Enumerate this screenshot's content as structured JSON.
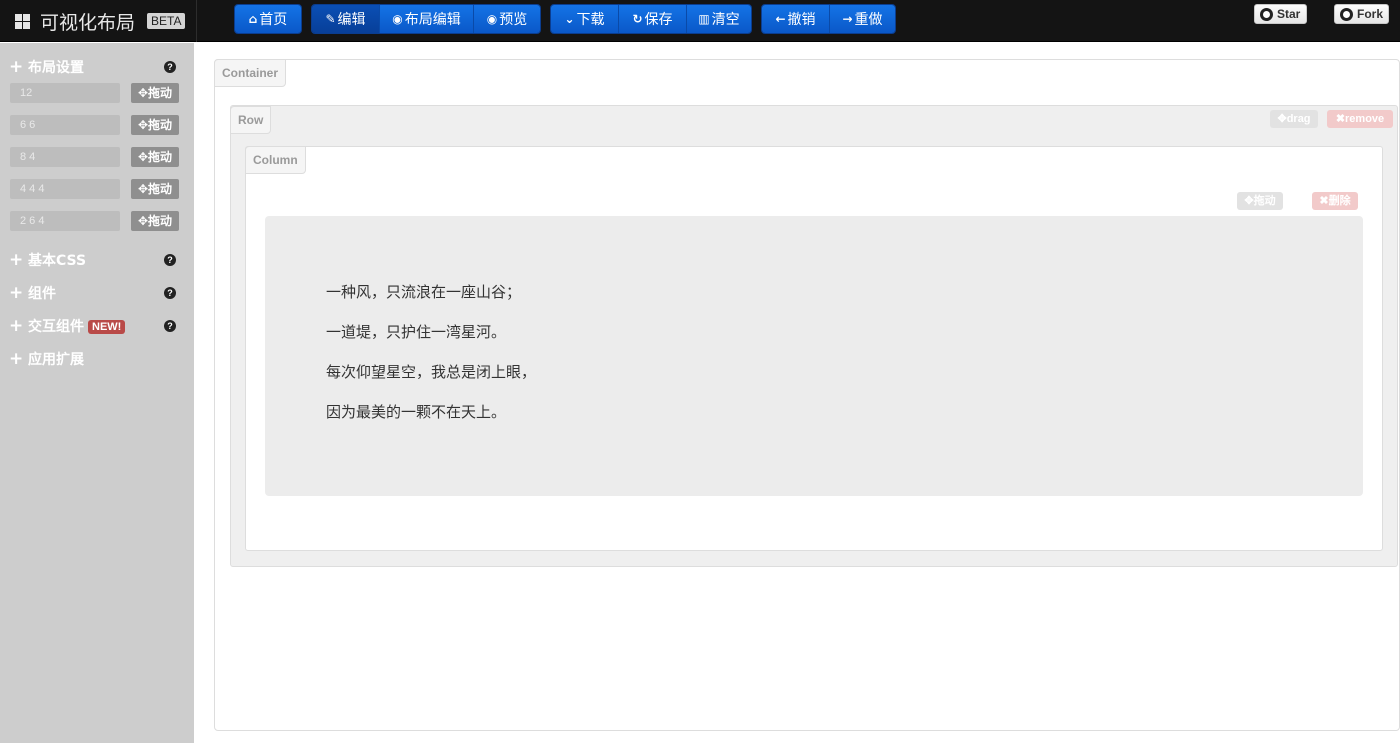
{
  "app": {
    "title": "可视化布局",
    "badge": "BETA"
  },
  "toolbar": {
    "home": "首页",
    "edit": "编辑",
    "layout_edit": "布局编辑",
    "preview": "预览",
    "download": "下载",
    "save": "保存",
    "clear": "清空",
    "undo": "撤销",
    "redo": "重做"
  },
  "github": {
    "star": "Star",
    "fork": "Fork"
  },
  "sidebar": {
    "layout_title": "布局设置",
    "help": "?",
    "grid_rows": [
      {
        "value": "12",
        "drag": "拖动"
      },
      {
        "value": "6 6",
        "drag": "拖动"
      },
      {
        "value": "8 4",
        "drag": "拖动"
      },
      {
        "value": "4 4 4",
        "drag": "拖动"
      },
      {
        "value": "2 6 4",
        "drag": "拖动"
      }
    ],
    "sections": [
      {
        "label": "基本CSS"
      },
      {
        "label": "组件"
      },
      {
        "label": "交互组件",
        "badge": "NEW!"
      },
      {
        "label": "应用扩展"
      }
    ]
  },
  "canvas": {
    "container_label": "Container",
    "row_label": "Row",
    "row_drag": "drag",
    "row_remove": "remove",
    "column_label": "Column",
    "col_drag": "拖动",
    "col_remove": "删除",
    "poem": [
      "一种风，只流浪在一座山谷；",
      "一道堤，只护住一湾星河。",
      "每次仰望星空，我总是闭上眼，",
      "因为最美的一颗不在天上。"
    ]
  }
}
